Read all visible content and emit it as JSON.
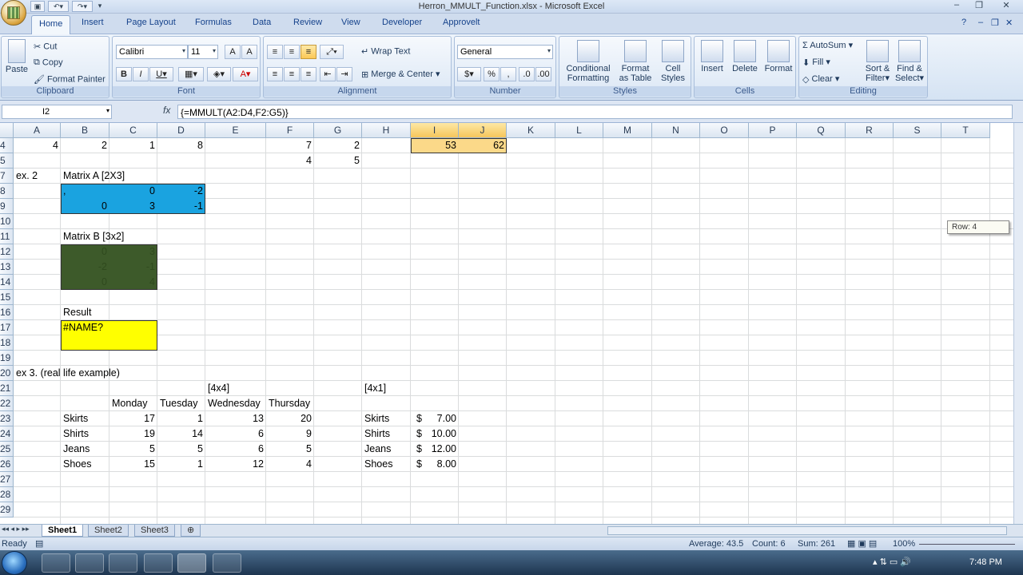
{
  "window": {
    "title": "Herron_MMULT_Function.xlsx - Microsoft Excel"
  },
  "tabs": [
    "Home",
    "Insert",
    "Page Layout",
    "Formulas",
    "Data",
    "Review",
    "View",
    "Developer",
    "Approvelt"
  ],
  "ribbon": {
    "clipboard": {
      "paste": "Paste",
      "cut": "Cut",
      "copy": "Copy",
      "format_painter": "Format Painter",
      "label": "Clipboard"
    },
    "font": {
      "name": "Calibri",
      "size": "11",
      "label": "Font"
    },
    "alignment": {
      "wrap": "Wrap Text",
      "merge": "Merge & Center",
      "label": "Alignment"
    },
    "number": {
      "format": "General",
      "label": "Number"
    },
    "styles": {
      "conditional": "Conditional",
      "conditional2": "Formatting",
      "format_table": "Format",
      "format_table2": "as Table",
      "cell_styles": "Cell",
      "cell_styles2": "Styles",
      "label": "Styles"
    },
    "cells": {
      "insert": "Insert",
      "delete": "Delete",
      "format": "Format",
      "label": "Cells"
    },
    "editing": {
      "autosum": "AutoSum",
      "fill": "Fill",
      "clear": "Clear",
      "sort": "Sort &",
      "sort2": "Filter",
      "find": "Find &",
      "find2": "Select",
      "label": "Editing"
    }
  },
  "formula_bar": {
    "name_box": "I2",
    "fx": "fx",
    "formula": "{=MMULT(A2:D4,F2:G5)}"
  },
  "columns": [
    "A",
    "B",
    "C",
    "D",
    "E",
    "F",
    "G",
    "H",
    "I",
    "J",
    "K",
    "L",
    "M",
    "N",
    "O",
    "P",
    "Q",
    "R",
    "S",
    "T"
  ],
  "rows": [
    "4",
    "5",
    "7",
    "8",
    "9",
    "10",
    "11",
    "12",
    "13",
    "14",
    "15",
    "16",
    "17",
    "18",
    "19",
    "20",
    "21",
    "22",
    "23",
    "24",
    "25",
    "26",
    "27",
    "28",
    "29"
  ],
  "cells": {
    "A4": "4",
    "B4": "2",
    "C4": "1",
    "D4": "8",
    "F4": "7",
    "G4": "2",
    "I4": "53",
    "J4": "62",
    "F5": "4",
    "G5": "5",
    "A7": "ex. 2",
    "B7": "Matrix A [2X3]",
    "B8": ",",
    "C8": "0",
    "D8": "-2",
    "B9": "0",
    "C9": "3",
    "D9": "-1",
    "B11": "Matrix B [3x2]",
    "B12": "0",
    "C12": "3",
    "B13": "-2",
    "C13": "-1",
    "B14": "0",
    "C14": "4",
    "B16": "Result",
    "B17": "#NAME?",
    "A20": "ex 3. (real life example)",
    "E21": "[4x4]",
    "H21": "[4x1]",
    "C22": "Monday",
    "D22": "Tuesday",
    "E22": "Wednesday",
    "F22": "Thursday",
    "B23": "Skirts",
    "C23": "17",
    "D23": "1",
    "E23": "13",
    "F23": "20",
    "H23": "Skirts",
    "I23a": "$",
    "I23": "7.00",
    "B24": "Shirts",
    "C24": "19",
    "D24": "14",
    "E24": "6",
    "F24": "9",
    "H24": "Shirts",
    "I24a": "$",
    "I24": "10.00",
    "B25": "Jeans",
    "C25": "5",
    "D25": "5",
    "E25": "6",
    "F25": "5",
    "H25": "Jeans",
    "I25a": "$",
    "I25": "12.00",
    "B26": "Shoes",
    "C26": "15",
    "D26": "1",
    "E26": "12",
    "F26": "4",
    "H26": "Shoes",
    "I26a": "$",
    "I26": "8.00"
  },
  "tooltip": "Row: 4",
  "sheets": [
    "Sheet1",
    "Sheet2",
    "Sheet3"
  ],
  "status": {
    "ready": "Ready",
    "average": "Average: 43.5",
    "count": "Count: 6",
    "sum": "Sum: 261",
    "zoom": "100%"
  },
  "clock": "7:48 PM",
  "colors": {
    "blue_fill": "#1aa3e0",
    "green_fill": "#3d5a2a",
    "yellow_fill": "#ffff00",
    "selection": "#fbd989"
  }
}
